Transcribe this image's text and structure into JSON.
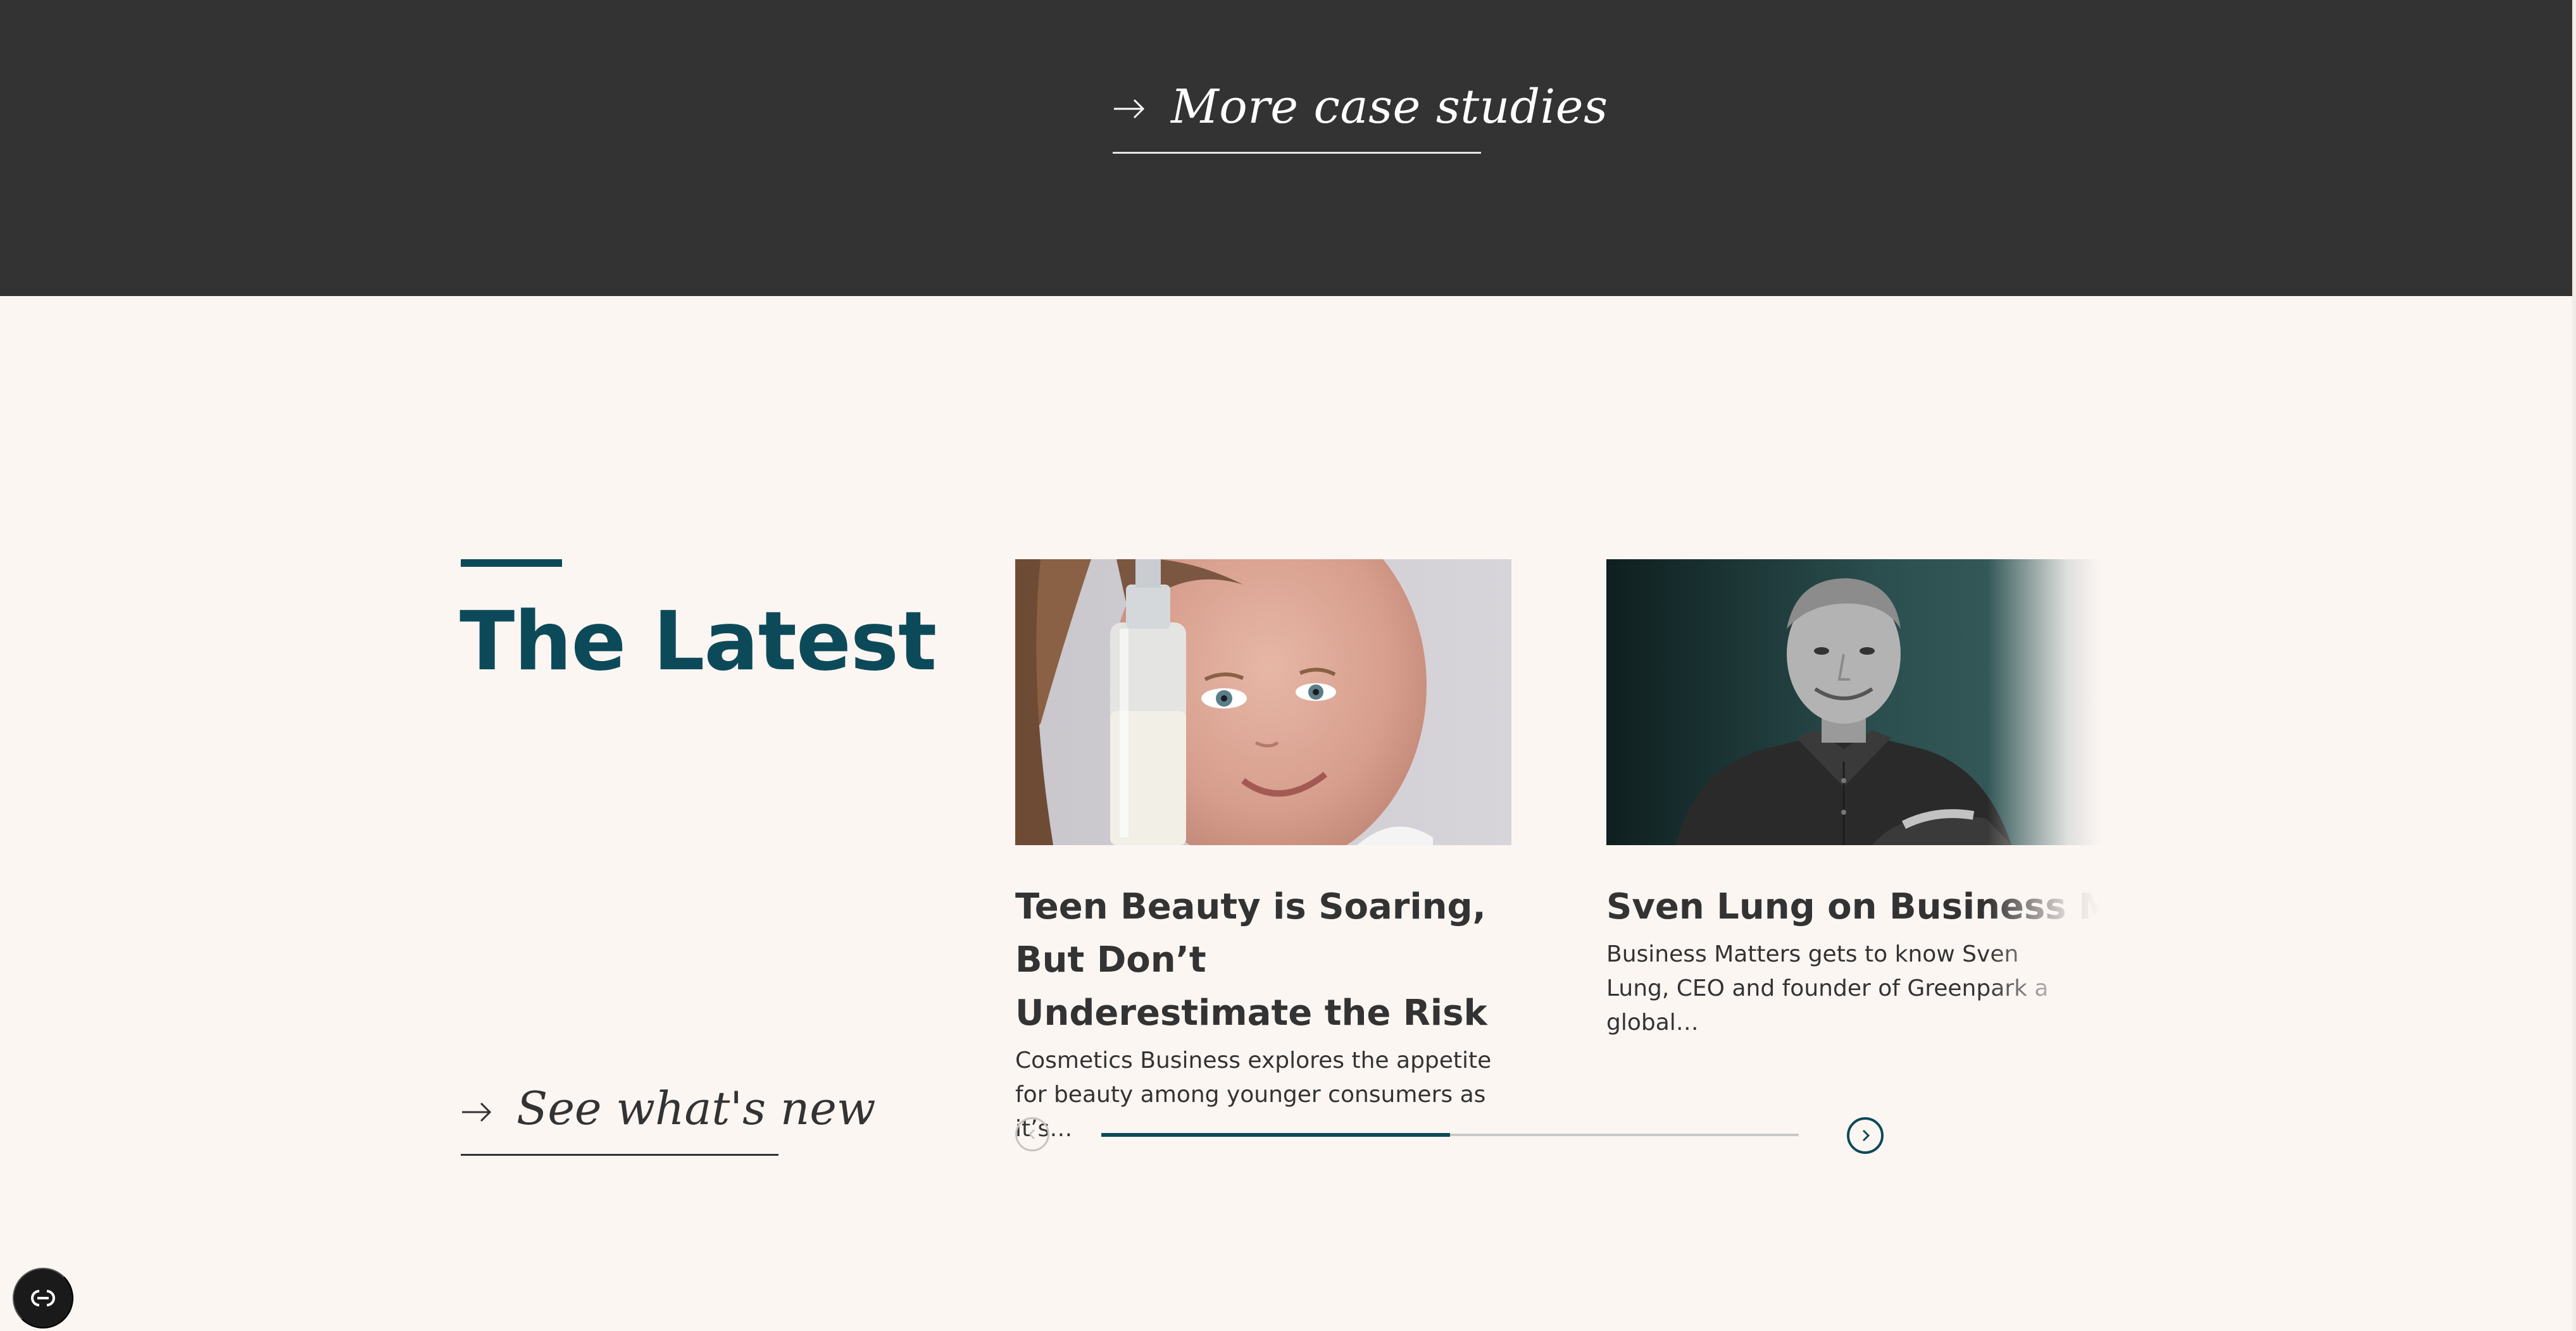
{
  "case_studies": {
    "link_label": "More case studies",
    "arrow_icon": "arrow-right-icon"
  },
  "latest": {
    "title": "The Latest",
    "see_label": "See what's new",
    "arrow_icon": "arrow-right-icon"
  },
  "articles": [
    {
      "title": "Teen Beauty is Soaring, But Don’t Underestimate the Risk",
      "excerpt": "Cosmetics Business explores the appetite for beauty among younger consumers as it’s…",
      "image_icon": "teen-beauty-photo"
    },
    {
      "title": "Sven Lung on Business Matters",
      "excerpt": "Business Matters gets to know Sven Lung, CEO and founder of Greenpark a global…",
      "image_icon": "portrait-photo"
    }
  ],
  "carousel": {
    "progress": 0.5,
    "prev_icon": "chevron-left-icon",
    "next_icon": "chevron-right-icon"
  },
  "accessibility": {
    "icon": "accessibility-icon"
  },
  "colors": {
    "accent": "#0d4a59",
    "dark_band": "#333333",
    "background": "#fcf6f3"
  }
}
